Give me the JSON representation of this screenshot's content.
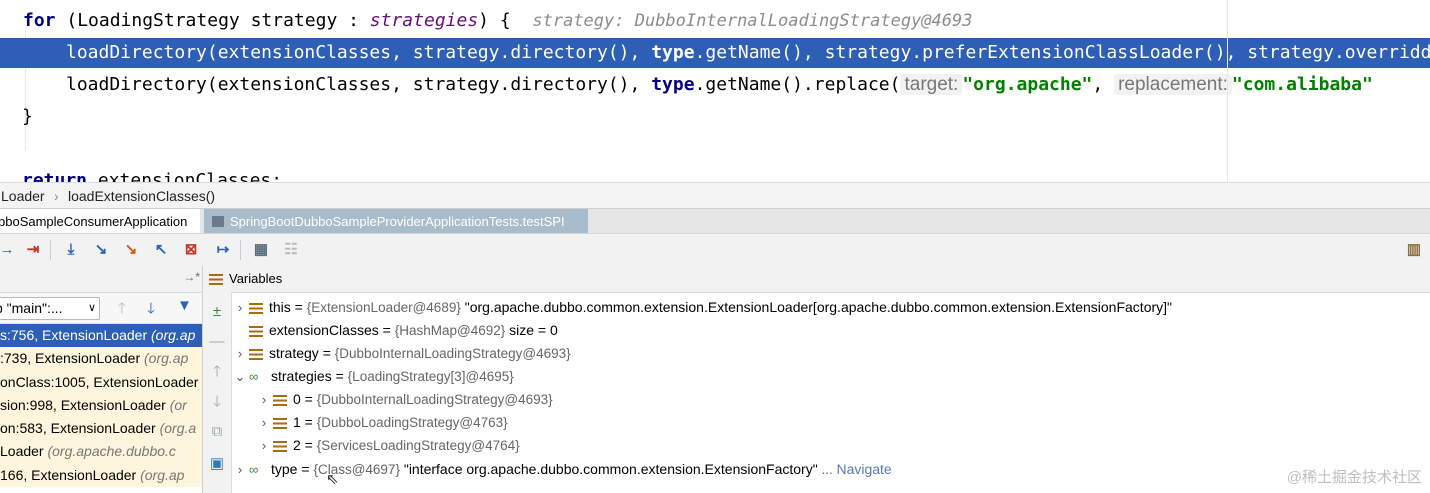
{
  "editor": {
    "lines": [
      {
        "kw": "for",
        "pre": " (LoadingStrategy strategy : ",
        "it": "strategies",
        "post": ") {",
        "comment": "strategy: DubboInternalLoadingStrategy@4693"
      },
      {
        "a": "loadDirectory(extensionClasses, strategy.directory(), ",
        "kw": "type",
        "b": ".getName(), strategy.preferExtensionClassLoader(), strategy.overridde"
      },
      {
        "a": "loadDirectory(extensionClasses, strategy.directory(), ",
        "kw": "type",
        "b": ".getName().replace(",
        "hint1": "target:",
        "str1": "\"org.apache\"",
        "sep": ", ",
        "hint2": "replacement:",
        "str2": "\"com.alibaba\""
      },
      {
        "text": "}"
      },
      {
        "kw": "return",
        "text": " extensionClasses;"
      }
    ]
  },
  "breadcrumb": {
    "a": "Loader",
    "sep": "›",
    "b": "loadExtensionClasses()"
  },
  "tabs": {
    "active": "bboSampleConsumerApplication",
    "inactive": "SpringBootDubboSampleProviderApplicationTests.testSPI"
  },
  "frames": {
    "thread": "p \"main\":...",
    "items": [
      {
        "loc": "s:756, ExtensionLoader ",
        "cls": "(org.ap"
      },
      {
        "loc": ":739, ExtensionLoader ",
        "cls": "(org.ap"
      },
      {
        "loc": "onClass:1005, ExtensionLoader",
        "cls": ""
      },
      {
        "loc": "sion:998, ExtensionLoader ",
        "cls": "(or"
      },
      {
        "loc": "on:583, ExtensionLoader ",
        "cls": "(org.a"
      },
      {
        "loc": "Loader ",
        "cls": "(org.apache.dubbo.c"
      },
      {
        "loc": "166, ExtensionLoader ",
        "cls": "(org.ap"
      }
    ]
  },
  "variables": {
    "title": "Variables",
    "rows": [
      {
        "name": "this",
        "eq": " = ",
        "type": "{ExtensionLoader@4689}",
        "val": " \"org.apache.dubbo.common.extension.ExtensionLoader[org.apache.dubbo.common.extension.ExtensionFactory]\""
      },
      {
        "name": "extensionClasses",
        "eq": " = ",
        "type": "{HashMap@4692}",
        "val": "  size = 0"
      },
      {
        "name": "strategy",
        "eq": " = ",
        "type": "{DubboInternalLoadingStrategy@4693}",
        "val": ""
      },
      {
        "name": "strategies",
        "eq": " = ",
        "type": "{LoadingStrategy[3]@4695}",
        "val": ""
      },
      {
        "name": "0",
        "eq": " = ",
        "type": "{DubboInternalLoadingStrategy@4693}",
        "val": ""
      },
      {
        "name": "1",
        "eq": " = ",
        "type": "{DubboLoadingStrategy@4763}",
        "val": ""
      },
      {
        "name": "2",
        "eq": " = ",
        "type": "{ServicesLoadingStrategy@4764}",
        "val": ""
      },
      {
        "name": "type",
        "eq": " = ",
        "type": "{Class@4697}",
        "val": " \"interface org.apache.dubbo.common.extension.ExtensionFactory\"",
        "more": " ... ",
        "nav": "Navigate"
      }
    ]
  },
  "watermark": "@稀土掘金技术社区"
}
